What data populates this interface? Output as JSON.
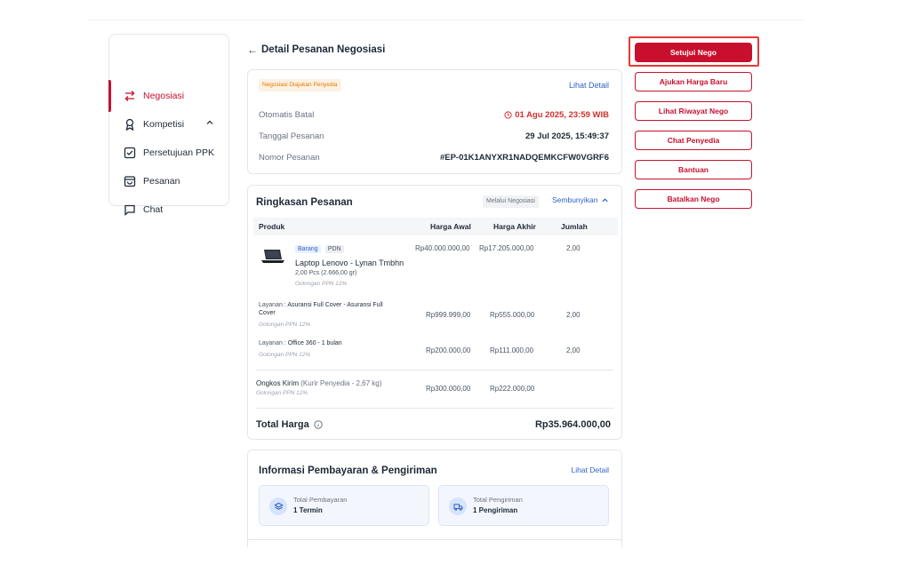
{
  "sidebar": {
    "items": [
      {
        "label": "Negosiasi",
        "icon": "swap-arrows-icon"
      },
      {
        "label": "Kompetisi",
        "icon": "award-icon"
      },
      {
        "label": "Persetujuan PPK",
        "icon": "checkbox-icon"
      },
      {
        "label": "Pesanan",
        "icon": "bag-icon"
      },
      {
        "label": "Chat",
        "icon": "chat-bubble-icon"
      }
    ]
  },
  "page": {
    "title": "Detail Pesanan Negosiasi"
  },
  "status_card": {
    "badge": "Negosiasi Diajukan Penyedia",
    "detail_link": "Lihat Detail",
    "rows": [
      {
        "label": "Otomatis Batal",
        "value": "01 Agu 2025, 23:59 WIB"
      },
      {
        "label": "Tanggal Pesanan",
        "value": "29 Jul 2025, 15:49:37"
      },
      {
        "label": "Nomor Pesanan",
        "value": "#EP-01K1ANYXR1NADQEMKCFW0VGRF6"
      }
    ]
  },
  "summary": {
    "title": "Ringkasan Pesanan",
    "via_badge": "Melalui Negosiasi",
    "hide_link": "Sembunyikan",
    "columns": [
      "Produk",
      "Harga Awal",
      "Harga Akhir",
      "Jumlah"
    ],
    "product": {
      "tags": [
        "Barang",
        "PDN"
      ],
      "name": "Laptop Lenovo - Lynan Tmbhn",
      "qty_detail": "2,00 Pcs (2.666,00 gr)",
      "tax": "Golongan PPN 12%",
      "harga_awal": "Rp40.000.000,00",
      "harga_akhir": "Rp17.205.000,00",
      "jumlah": "2,00"
    },
    "services": [
      {
        "prefix": "Layanan :",
        "name": "Asuransi Full Cover - Asuransi Full Cover",
        "tax": "Golongan PPN 12%",
        "harga_awal": "Rp999.999,00",
        "harga_akhir": "Rp555.000,00",
        "jumlah": "2,00"
      },
      {
        "prefix": "Layanan :",
        "name": "Office 360 - 1 bulan",
        "tax": "Golongan PPN 12%",
        "harga_awal": "Rp200.000,00",
        "harga_akhir": "Rp111.000,00",
        "jumlah": "2,00"
      }
    ],
    "shipping": {
      "label": "Ongkos Kirim",
      "detail": "(Kurir Penyedia - 2,67 kg)",
      "tax": "Golongan PPN 12%",
      "harga_awal": "Rp300.000,00",
      "harga_akhir": "Rp222.000,00"
    },
    "total_label": "Total Harga",
    "total_value": "Rp35.964.000,00"
  },
  "payment": {
    "title": "Informasi Pembayaran & Pengiriman",
    "detail_link": "Lihat Detail",
    "boxes": [
      {
        "label": "Total Pembayaran",
        "value": "1 Termin"
      },
      {
        "label": "Total Pengiriman",
        "value": "1 Pengiriman"
      }
    ]
  },
  "actions": {
    "approve": "Setujui Nego",
    "new_price": "Ajukan Harga Baru",
    "history": "Lihat Riwayat Nego",
    "chat": "Chat Penyedia",
    "help": "Bantuan",
    "cancel": "Batalkan Nego"
  },
  "colors": {
    "brand": "#c8102e",
    "link": "#2f62c9",
    "warning": "#e07b00",
    "highlight": "#e53935"
  }
}
